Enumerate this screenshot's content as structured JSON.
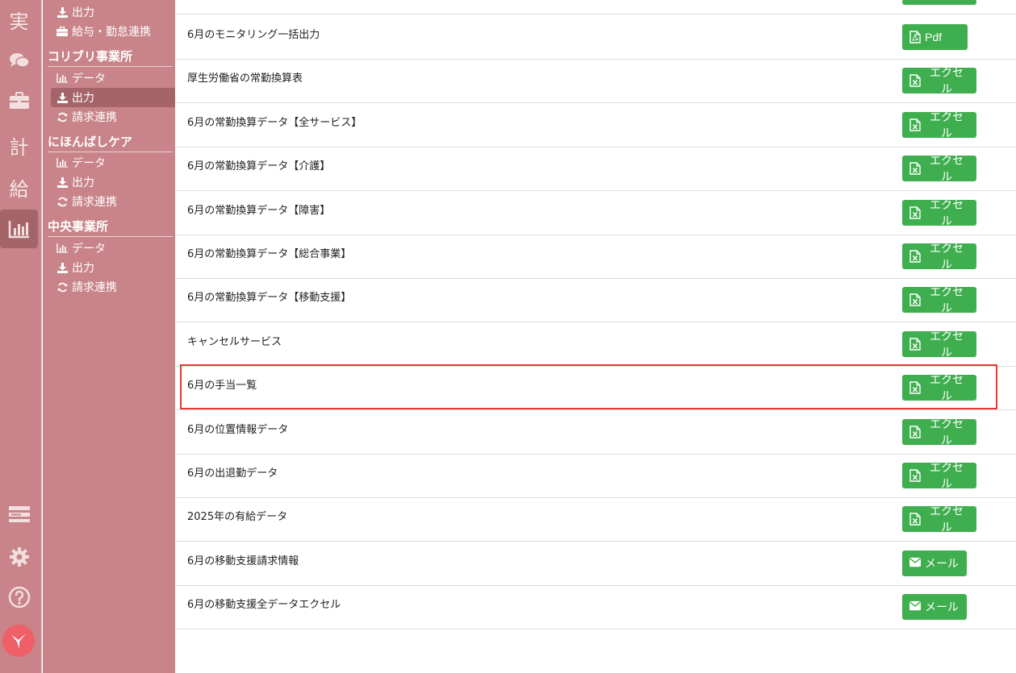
{
  "rail": {
    "items": [
      {
        "label": "実"
      },
      {
        "label": "chat-icon"
      },
      {
        "label": "briefcase-icon"
      },
      {
        "label": "計"
      },
      {
        "label": "給"
      },
      {
        "label": "chart-icon"
      }
    ],
    "bottom": [
      "list-icon",
      "gear-icon",
      "help-icon",
      "logo-icon"
    ]
  },
  "subnav": {
    "top_items": [
      {
        "label": "出力",
        "icon": "download-icon"
      },
      {
        "label": "給与・勤怠連携",
        "icon": "briefcase-icon"
      }
    ],
    "sections": [
      {
        "title": "コリブリ事業所",
        "items": [
          {
            "label": "データ",
            "icon": "chart-icon"
          },
          {
            "label": "出力",
            "icon": "download-icon",
            "active": true
          },
          {
            "label": "請求連携",
            "icon": "refresh-icon"
          }
        ]
      },
      {
        "title": "にほんばしケア",
        "items": [
          {
            "label": "データ",
            "icon": "chart-icon"
          },
          {
            "label": "出力",
            "icon": "download-icon"
          },
          {
            "label": "請求連携",
            "icon": "refresh-icon"
          }
        ]
      },
      {
        "title": "中央事業所",
        "items": [
          {
            "label": "データ",
            "icon": "chart-icon"
          },
          {
            "label": "出力",
            "icon": "download-icon"
          },
          {
            "label": "請求連携",
            "icon": "refresh-icon"
          }
        ]
      }
    ]
  },
  "rows": [
    {
      "label": "6月のモニタリング一括出力",
      "button": "Pdf",
      "type": "pdf"
    },
    {
      "label": "厚生労働省の常勤換算表",
      "button": "エクセル",
      "type": "excel"
    },
    {
      "label": "6月の常勤換算データ【全サービス】",
      "button": "エクセル",
      "type": "excel"
    },
    {
      "label": "6月の常勤換算データ【介護】",
      "button": "エクセル",
      "type": "excel"
    },
    {
      "label": "6月の常勤換算データ【障害】",
      "button": "エクセル",
      "type": "excel"
    },
    {
      "label": "6月の常勤換算データ【総合事業】",
      "button": "エクセル",
      "type": "excel"
    },
    {
      "label": "6月の常勤換算データ【移動支援】",
      "button": "エクセル",
      "type": "excel"
    },
    {
      "label": "キャンセルサービス",
      "button": "エクセル",
      "type": "excel"
    },
    {
      "label": "6月の手当一覧",
      "button": "エクセル",
      "type": "excel",
      "highlighted": true
    },
    {
      "label": "6月の位置情報データ",
      "button": "エクセル",
      "type": "excel"
    },
    {
      "label": "6月の出退勤データ",
      "button": "エクセル",
      "type": "excel"
    },
    {
      "label": "2025年の有給データ",
      "button": "エクセル",
      "type": "excel"
    },
    {
      "label": "6月の移動支援請求情報",
      "button": "メール",
      "type": "mail"
    },
    {
      "label": "6月の移動支援全データエクセル",
      "button": "メール",
      "type": "mail"
    }
  ],
  "colors": {
    "sidebar": "#c88488",
    "sidebar_active": "#a56468",
    "button_green": "#3fae4e",
    "highlight_red": "#e53935"
  }
}
